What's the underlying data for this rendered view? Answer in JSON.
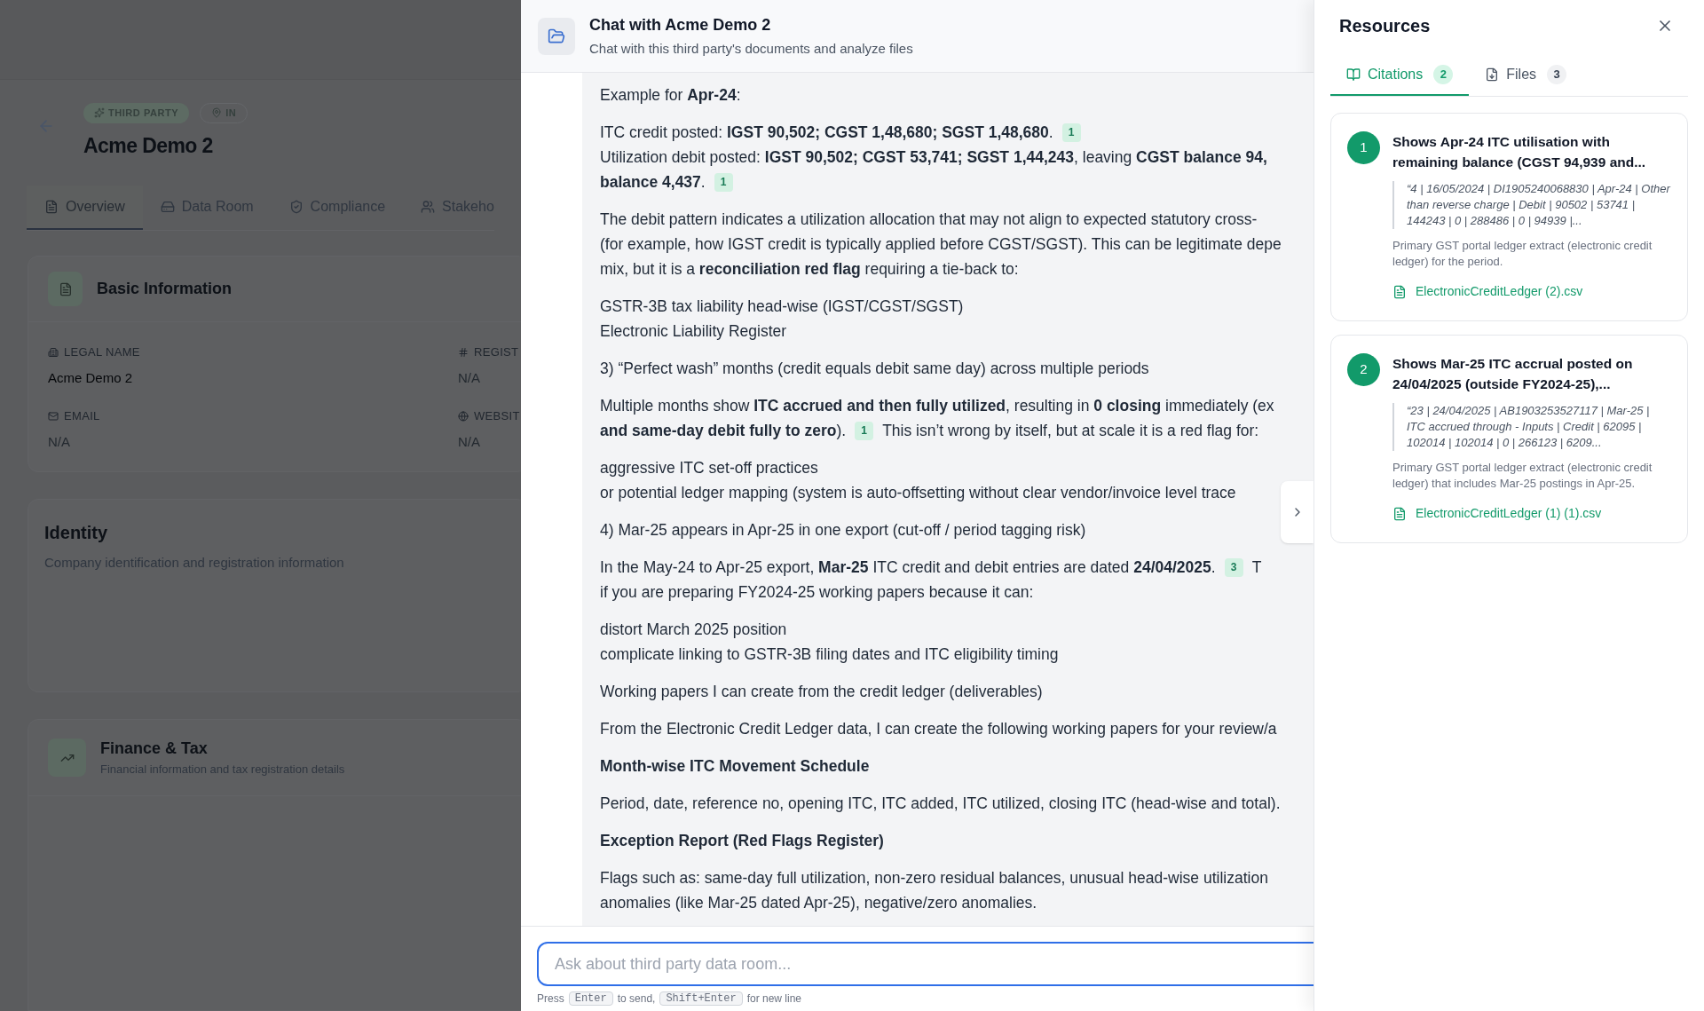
{
  "page": {
    "badges": [
      {
        "kind": "type",
        "label": "THIRD PARTY"
      },
      {
        "kind": "location",
        "label": "IN"
      }
    ],
    "title": "Acme Demo 2",
    "tabs": [
      {
        "label": "Overview",
        "selected": true
      },
      {
        "label": "Data Room",
        "selected": false
      },
      {
        "label": "Compliance",
        "selected": false
      },
      {
        "label": "Stakeho",
        "selected": false
      }
    ],
    "basic": {
      "title": "Basic Information",
      "fields": [
        {
          "label": "LEGAL NAME",
          "value": "Acme Demo 2",
          "muted": false
        },
        {
          "label": "REGIST",
          "value": "N/A",
          "muted": true
        },
        {
          "label": "EMAIL",
          "value": "N/A",
          "muted": true
        },
        {
          "label": "WEBSIT",
          "value": "N/A",
          "muted": true
        }
      ]
    },
    "identity": {
      "title": "Identity",
      "subtitle": "Company identification and registration information"
    },
    "finance": {
      "title": "Finance & Tax",
      "subtitle": "Financial information and tax registration details"
    }
  },
  "chat": {
    "title": "Chat with Acme Demo 2",
    "subtitle": "Chat with this third party's documents and analyze files",
    "paragraphs": [
      {
        "kind": "body",
        "lines": [
          [
            {
              "kind": "text",
              "text": "Example for **Apr-24**:"
            }
          ]
        ]
      },
      {
        "kind": "body",
        "lines": [
          [
            {
              "kind": "text",
              "text": "ITC credit posted: **IGST 90,502; CGST 1,48,680; SGST 1,48,680**."
            },
            {
              "kind": "cite",
              "text": "1"
            }
          ],
          [
            {
              "kind": "text",
              "text": "Utilization debit posted: **IGST 90,502; CGST 53,741; SGST 1,44,243**, leaving **CGST balance 94,**"
            }
          ],
          [
            {
              "kind": "text",
              "text": "**balance 4,437**."
            },
            {
              "kind": "cite",
              "text": "1"
            }
          ]
        ]
      },
      {
        "kind": "body",
        "lines": [
          [
            {
              "kind": "text",
              "text": "The debit pattern indicates a utilization allocation that may not align to expected statutory cross-"
            }
          ],
          [
            {
              "kind": "text",
              "text": "(for example, how IGST credit is typically applied before CGST/SGST). This can be legitimate depe"
            }
          ],
          [
            {
              "kind": "text",
              "text": "mix, but it is a **reconciliation red flag** requiring a tie-back to:"
            }
          ]
        ]
      },
      {
        "kind": "body",
        "lines": [
          [
            {
              "kind": "text",
              "text": "GSTR-3B tax liability head-wise (IGST/CGST/SGST)"
            }
          ],
          [
            {
              "kind": "text",
              "text": "Electronic Liability Register"
            }
          ]
        ]
      },
      {
        "kind": "body",
        "lines": [
          [
            {
              "kind": "text",
              "text": "3) “Perfect wash” months (credit equals debit same day) across multiple periods"
            }
          ]
        ]
      },
      {
        "kind": "body",
        "lines": [
          [
            {
              "kind": "text",
              "text": "Multiple months show **ITC accrued and then fully utilized**, resulting in **0 closing** immediately (ex"
            }
          ],
          [
            {
              "kind": "text",
              "text": "**and same-day debit fully to zero**)."
            },
            {
              "kind": "cite",
              "text": "1"
            },
            {
              "kind": "text",
              "text": "This isn’t wrong by itself, but at scale it is a red flag for:"
            }
          ]
        ]
      },
      {
        "kind": "body",
        "lines": [
          [
            {
              "kind": "text",
              "text": "aggressive ITC set-off practices"
            }
          ],
          [
            {
              "kind": "text",
              "text": "or potential ledger mapping (system is auto-offsetting without clear vendor/invoice level trace"
            }
          ]
        ]
      },
      {
        "kind": "body",
        "lines": [
          [
            {
              "kind": "text",
              "text": "4) Mar-25 appears in Apr-25 in one export (cut-off / period tagging risk)"
            }
          ]
        ]
      },
      {
        "kind": "body",
        "lines": [
          [
            {
              "kind": "text",
              "text": "In the May-24 to Apr-25 export, **Mar-25** ITC credit and debit entries are dated **24/04/2025**."
            },
            {
              "kind": "cite",
              "text": "3"
            },
            {
              "kind": "text",
              "text": "T"
            }
          ],
          [
            {
              "kind": "text",
              "text": "if you are preparing FY2024-25 working papers because it can:"
            }
          ]
        ]
      },
      {
        "kind": "body",
        "lines": [
          [
            {
              "kind": "text",
              "text": "distort March 2025 position"
            }
          ],
          [
            {
              "kind": "text",
              "text": "complicate linking to GSTR-3B filing dates and ITC eligibility timing"
            }
          ]
        ]
      },
      {
        "kind": "body",
        "lines": [
          [
            {
              "kind": "text",
              "text": "Working papers I can create from the credit ledger (deliverables)"
            }
          ]
        ]
      },
      {
        "kind": "body",
        "lines": [
          [
            {
              "kind": "text",
              "text": "From the Electronic Credit Ledger data, I can create the following working papers for your review/a"
            }
          ]
        ]
      },
      {
        "kind": "heading",
        "lines": [
          [
            {
              "kind": "text",
              "text": "Month-wise ITC Movement Schedule"
            }
          ]
        ]
      },
      {
        "kind": "body",
        "lines": [
          [
            {
              "kind": "text",
              "text": "Period, date, reference no, opening ITC, ITC added, ITC utilized, closing ITC (head-wise and total)."
            }
          ]
        ]
      },
      {
        "kind": "heading",
        "lines": [
          [
            {
              "kind": "text",
              "text": "Exception Report (Red Flags Register)"
            }
          ]
        ]
      },
      {
        "kind": "body",
        "lines": [
          [
            {
              "kind": "text",
              "text": "Flags such as: same-day full utilization, non-zero residual balances, unusual head-wise utilization"
            }
          ],
          [
            {
              "kind": "text",
              "text": "anomalies (like Mar-25 dated Apr-25), negative/zero anomalies."
            }
          ]
        ]
      }
    ],
    "input": {
      "placeholder": "Ask about third party data room..."
    },
    "hint": [
      {
        "kind": "text",
        "text": "Press"
      },
      {
        "kind": "key",
        "text": "Enter"
      },
      {
        "kind": "text",
        "text": "to send,"
      },
      {
        "kind": "key",
        "text": "Shift+Enter"
      },
      {
        "kind": "text",
        "text": "for new line"
      }
    ]
  },
  "resources": {
    "title": "Resources",
    "tabs": [
      {
        "kind": "citations",
        "label": "Citations",
        "count": "2",
        "selected": true
      },
      {
        "kind": "files",
        "label": "Files",
        "count": "3",
        "selected": false
      }
    ],
    "citations": [
      {
        "number": "1",
        "title": "Shows Apr-24 ITC utilisation with remaining balance (CGST 94,939 and...",
        "quote": "“4 | 16/05/2024 | DI1905240068830 | Apr-24 | Other than reverse charge | Debit | 90502 | 53741 | 144243 | 0 | 288486 | 0 | 94939 |...",
        "description": "Primary GST portal ledger extract (electronic credit ledger) for the period.",
        "file": "ElectronicCreditLedger (2).csv"
      },
      {
        "number": "2",
        "title": "Shows Mar-25 ITC accrual posted on 24/04/2025 (outside FY2024-25),...",
        "quote": "“23 | 24/04/2025 | AB1903253527117 | Mar-25 | ITC accrued through - Inputs | Credit | 62095 | 102014 | 102014 | 0 | 266123 | 6209...",
        "description": "Primary GST portal ledger extract (electronic credit ledger) that includes Mar-25 postings in Apr-25.",
        "file": "ElectronicCreditLedger (1) (1).csv"
      }
    ]
  }
}
